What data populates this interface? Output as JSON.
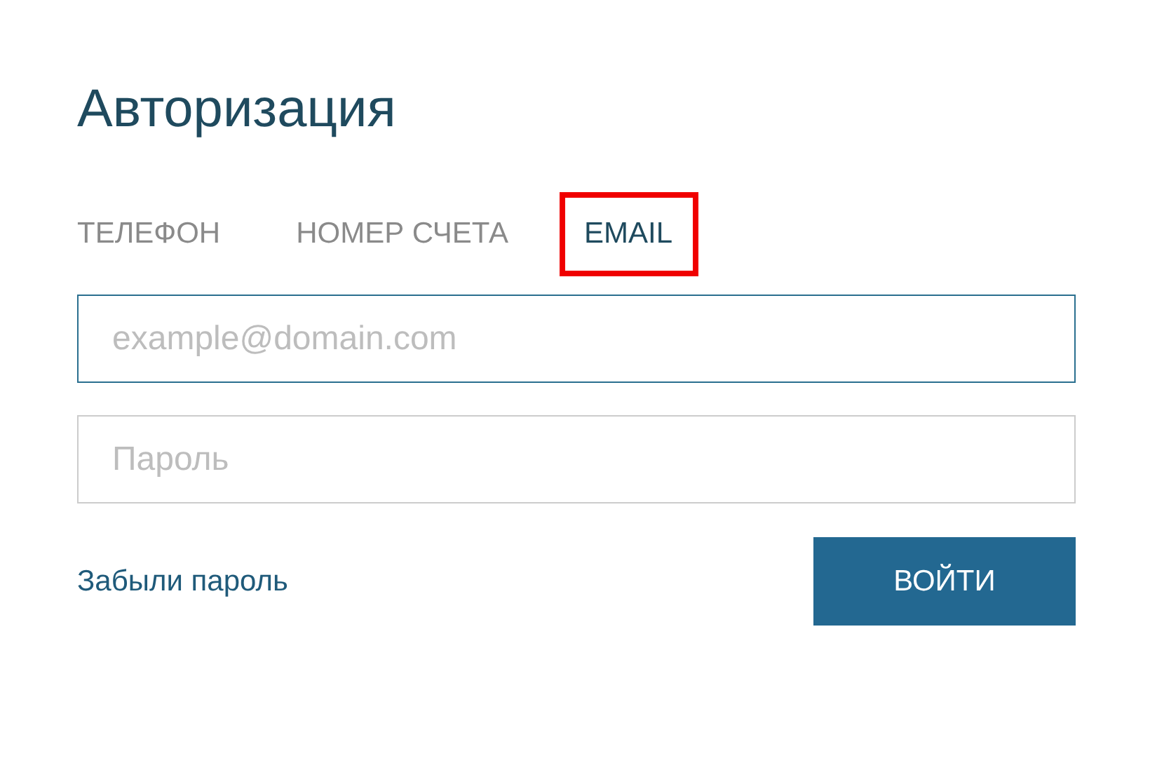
{
  "title": "Авторизация",
  "tabs": [
    {
      "label": "ТЕЛЕФОН",
      "selected": false,
      "highlighted": false
    },
    {
      "label": "НОМЕР СЧЕТА",
      "selected": false,
      "highlighted": false
    },
    {
      "label": "EMAIL",
      "selected": true,
      "highlighted": true
    }
  ],
  "email_field": {
    "placeholder": "example@domain.com",
    "focused": true
  },
  "password_field": {
    "placeholder": "Пароль",
    "focused": false
  },
  "forgot_link": "Забыли пароль",
  "login_button": "ВОЙТИ"
}
